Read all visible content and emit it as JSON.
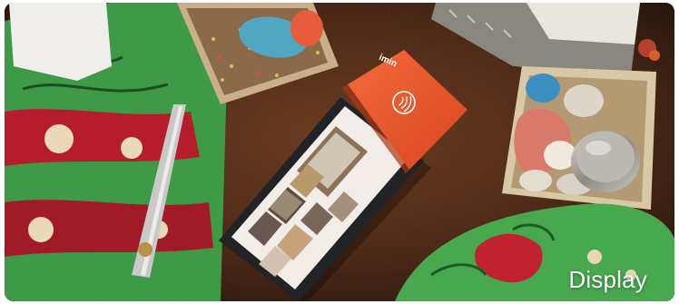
{
  "caption": "Display",
  "device": {
    "brand": "imin",
    "body_color": "#ea5a2e",
    "screen_color": "#f2ede8"
  },
  "colors": {
    "table": "#4a2a1a",
    "fabric_green": "#3d9a4a",
    "fabric_red": "#b81e2e"
  }
}
